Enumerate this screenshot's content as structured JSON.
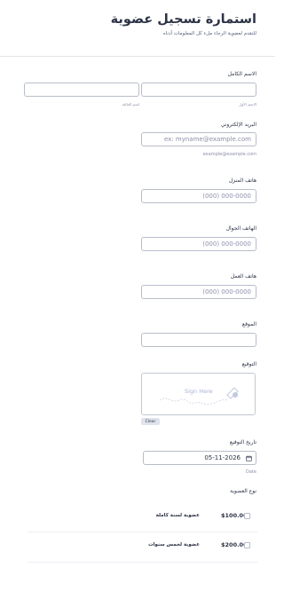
{
  "form": {
    "title": "استمارة تسجيل عضوية",
    "subtitle": "للتقدم لعضوية الرجاء ملء كل المعلومات أدناه"
  },
  "fields": {
    "full_name": {
      "label": "الاسم الكامل",
      "first_sublabel": "الاسم الأول",
      "last_sublabel": "اسم العائلة",
      "first_value": "",
      "last_value": ""
    },
    "email": {
      "label": "البريد الإلكتروني",
      "placeholder": "ex: myname@example.com",
      "sublabel": "example@example.com"
    },
    "home_phone": {
      "label": "هاتف المنزل",
      "placeholder": "(000) 000-0000"
    },
    "mobile_phone": {
      "label": "الهاتف الجوال",
      "placeholder": "(000) 000-0000"
    },
    "work_phone": {
      "label": "هاتف العمل",
      "placeholder": "(000) 000-0000"
    },
    "website": {
      "label": "الموقع",
      "value": ""
    },
    "signature": {
      "label": "التوقيع",
      "placeholder": "Sign Here",
      "clear_label": "Clear"
    },
    "signature_date": {
      "label": "تاريخ التوقيع",
      "value": "05-11-2026",
      "sublabel": "Date"
    },
    "membership_type": {
      "label": "نوع العضوية"
    }
  },
  "products": [
    {
      "name": "عضوية لسنة كاملة",
      "price": "$100.00"
    },
    {
      "name": "عضوية لخمس سنوات",
      "price": "$200.00"
    }
  ]
}
